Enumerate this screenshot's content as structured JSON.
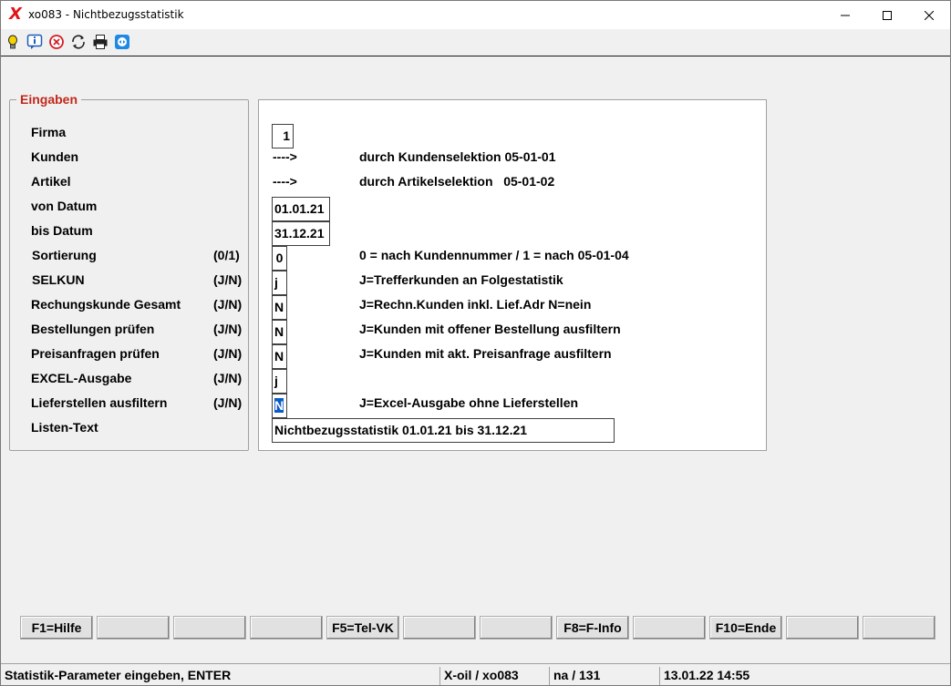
{
  "window": {
    "logo": "X",
    "title": "xo083 - Nichtbezugsstatistik"
  },
  "toolbar_icons": [
    "lightbulb-icon",
    "info-icon",
    "cancel-icon",
    "refresh-icon",
    "printer-icon",
    "remote-icon"
  ],
  "group": {
    "legend": "Eingaben"
  },
  "labels": [
    {
      "text": "Firma",
      "hint": ""
    },
    {
      "text": "Kunden",
      "hint": ""
    },
    {
      "text": "Artikel",
      "hint": ""
    },
    {
      "text": "von Datum",
      "hint": ""
    },
    {
      "text": "bis Datum",
      "hint": ""
    },
    {
      "text": "Sortierung",
      "hint": "(0/1)"
    },
    {
      "text": "SELKUN",
      "hint": "(J/N)"
    },
    {
      "text": "Rechungskunde Gesamt",
      "hint": "(J/N)"
    },
    {
      "text": "Bestellungen prüfen",
      "hint": "(J/N)"
    },
    {
      "text": "Preisanfragen prüfen",
      "hint": "(J/N)"
    },
    {
      "text": "EXCEL-Ausgabe",
      "hint": "(J/N)"
    },
    {
      "text": "Lieferstellen ausfiltern",
      "hint": "(J/N)"
    },
    {
      "text": "Listen-Text",
      "hint": ""
    }
  ],
  "fields": {
    "firma": "1",
    "von_datum": "01.01.21",
    "bis_datum": "31.12.21",
    "sortierung": "0",
    "selkun": "j",
    "rechnungskunde": "N",
    "bestellungen": "N",
    "preisanfragen": "N",
    "excel": "j",
    "lieferstellen": "N",
    "listen_text": "Nichtbezugsstatistik 01.01.21 bis 31.12.21"
  },
  "arrows": {
    "kunden": "---->",
    "artikel": "---->"
  },
  "descriptions": {
    "kunden": "durch Kundenselektion 05-01-01",
    "artikel": "durch Artikelselektion   05-01-02",
    "sortierung": "0 = nach Kundennummer / 1 = nach 05-01-04",
    "selkun": "J=Trefferkunden an Folgestatistik",
    "rechnungskunde": "J=Rechn.Kunden inkl. Lief.Adr N=nein",
    "bestellungen": "J=Kunden mit offener Bestellung ausfiltern",
    "preisanfragen": "J=Kunden mit akt. Preisanfrage ausfiltern",
    "lieferstellen": "J=Excel-Ausgabe ohne Lieferstellen"
  },
  "fkeys": [
    "F1=Hilfe",
    "",
    "",
    "",
    "F5=Tel-VK",
    "",
    "",
    "F8=F-Info",
    "",
    "F10=Ende",
    "",
    ""
  ],
  "status": {
    "message": "Statistik-Parameter eingeben, ENTER",
    "app": "X-oil / xo083",
    "info": "na / 131",
    "datetime": "13.01.22 14:55"
  },
  "colors": {
    "legend": "#c0281a",
    "logo": "#e0151b",
    "selection": "#0a5bc8"
  }
}
